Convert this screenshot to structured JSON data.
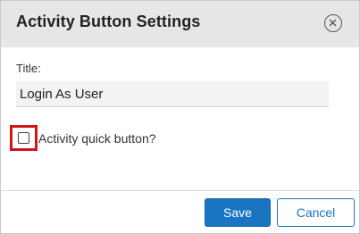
{
  "dialog": {
    "title": "Activity Button Settings",
    "close_icon": "close-icon"
  },
  "form": {
    "title_label": "Title:",
    "title_value": "Login As User",
    "quick_button_label": "Activity quick button?",
    "quick_button_checked": false
  },
  "footer": {
    "save_label": "Save",
    "cancel_label": "Cancel"
  },
  "colors": {
    "header_bg": "#e6e6e6",
    "primary": "#1a74c2",
    "highlight": "#d4141b"
  }
}
